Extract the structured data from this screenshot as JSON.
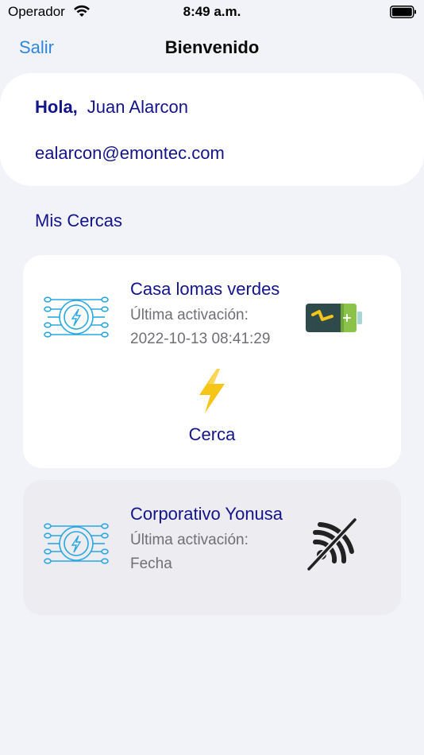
{
  "status_bar": {
    "carrier": "Operador",
    "time": "8:49 a.m."
  },
  "nav": {
    "back_label": "Salir",
    "title": "Bienvenido"
  },
  "user": {
    "greeting": "Hola,",
    "name": "Juan Alarcon",
    "email": "ealarcon@emontec.com"
  },
  "section_title": "Mis Cercas",
  "fences": [
    {
      "name": "Casa lomas verdes",
      "last_activation_label": "Última activación:",
      "last_activation": "2022-10-13 08:41:29",
      "status_icon": "battery-charging-icon",
      "action_label": "Cerca",
      "action_icon": "lightning-bolt-icon"
    },
    {
      "name": "Corporativo Yonusa",
      "last_activation_label": "Última activación:",
      "last_activation": "Fecha",
      "status_icon": "no-signal-icon"
    }
  ],
  "colors": {
    "background": "#f2f3f8",
    "card": "#ffffff",
    "card_inactive": "#ececf1",
    "primary_text": "#14148a",
    "secondary_text": "#6f6f74",
    "link": "#2f86de",
    "fence_icon": "#29a8e0",
    "bolt": "#f5c518",
    "battery_body": "#2f4a4a",
    "battery_charge": "#8bc34a"
  }
}
